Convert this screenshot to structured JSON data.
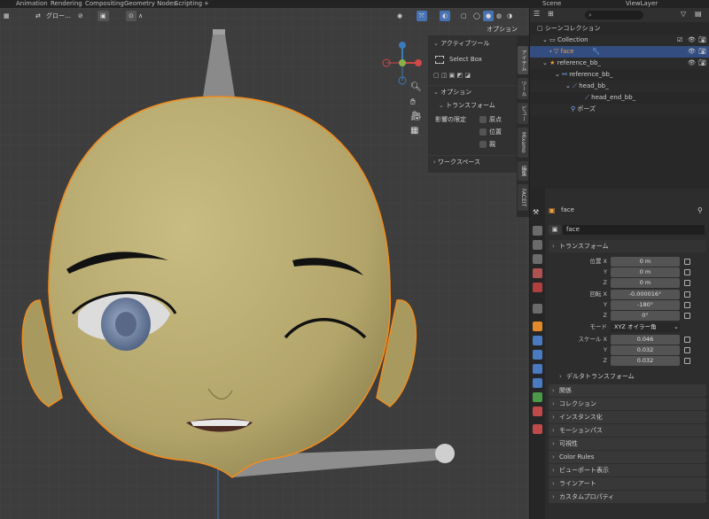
{
  "topbar": {
    "tabs": [
      "Animation",
      "Rendering",
      "Compositing",
      "Geometry Nodes",
      "Scripting",
      "+"
    ],
    "scene": "Scene",
    "view_layer": "ViewLayer"
  },
  "viewport": {
    "mode_select": "グロー…",
    "options_label": "オプション"
  },
  "tool_panel": {
    "active_tool_header": "アクティブツール",
    "select_box": "Select Box",
    "options_header": "オプション",
    "transform_header": "トランスフォーム",
    "affect_only": "影響の限定",
    "origin": "原点",
    "location": "位置",
    "parent": "親",
    "workspace": "ワークスペース"
  },
  "vertical_tabs": [
    "アイテム",
    "ツール",
    "ビュー",
    "Mixamo",
    "編集",
    "FACEIT"
  ],
  "outliner": {
    "rows": [
      {
        "label": "シーンコレクション",
        "depth": 0
      },
      {
        "label": "Collection",
        "depth": 1
      },
      {
        "label": "face",
        "depth": 2,
        "selected": true
      },
      {
        "label": "reference_bb_",
        "depth": 1
      },
      {
        "label": "reference_bb_",
        "depth": 2
      },
      {
        "label": "head_bb_",
        "depth": 3
      },
      {
        "label": "head_end_bb_",
        "depth": 4
      },
      {
        "label": "ポーズ",
        "depth": 3
      }
    ]
  },
  "properties": {
    "object_name": "face",
    "name_field": "face",
    "transform_header": "トランスフォーム",
    "location_label": "位置 X",
    "location": [
      "0 m",
      "0 m",
      "0 m"
    ],
    "rotation_label": "回転 X",
    "rotation": [
      "-0.000016°",
      "-180°",
      "0°"
    ],
    "mode_label": "モード",
    "mode_value": "XYZ オイラー角",
    "scale_label": "スケール X",
    "scale": [
      "0.046",
      "0.032",
      "0.032"
    ],
    "axis_y": "Y",
    "axis_z": "Z",
    "delta_transform": "デルタトランスフォーム",
    "panels": [
      "関係",
      "コレクション",
      "インスタンス化",
      "モーションパス",
      "可視性",
      "Color Rules",
      "ビューポート表示",
      "ラインアート",
      "カスタムプロパティ"
    ]
  },
  "colors": {
    "accent": "#4772b3",
    "selection_outline": "#f08c1e",
    "skin": "#b8aa6e"
  }
}
